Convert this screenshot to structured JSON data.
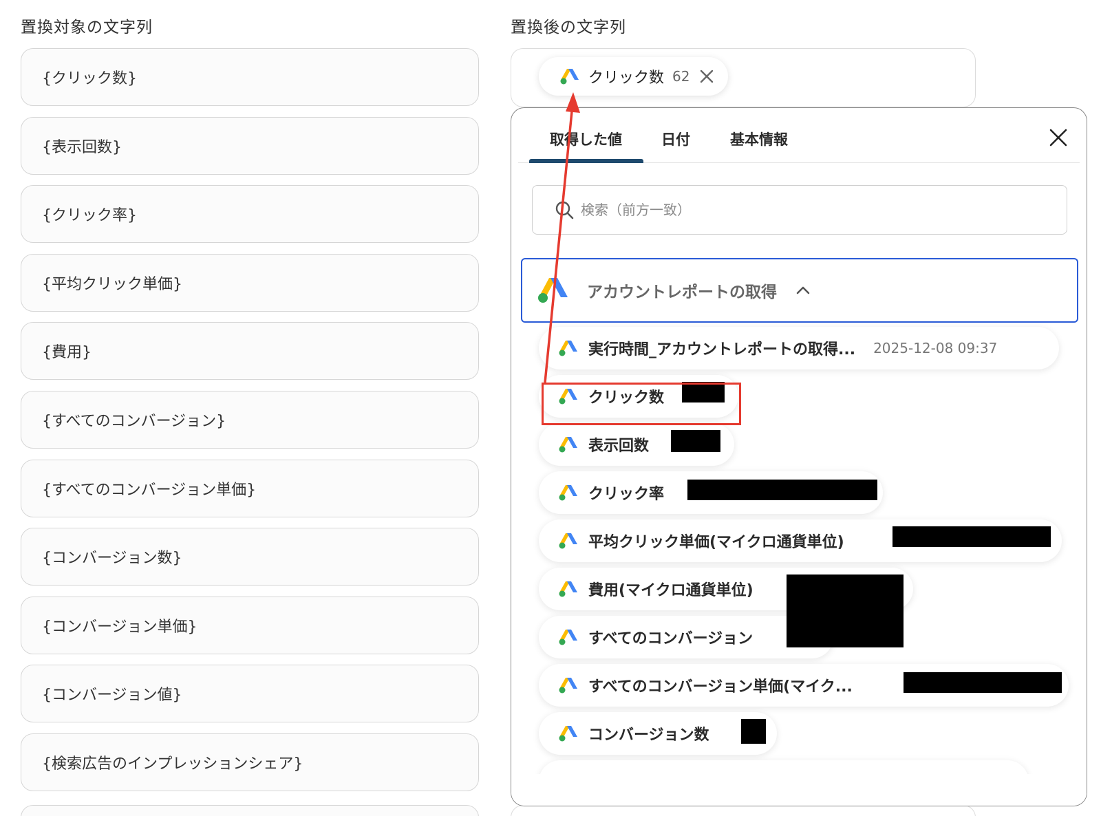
{
  "left": {
    "title": "置換対象の文字列",
    "items": [
      "{クリック数}",
      "{表示回数}",
      "{クリック率}",
      "{平均クリック単価}",
      "{費用}",
      "{すべてのコンバージョン}",
      "{すべてのコンバージョン単価}",
      "{コンバージョン数}",
      "{コンバージョン単価}",
      "{コンバージョン値}",
      "{検索広告のインプレッションシェア}"
    ]
  },
  "right": {
    "title": "置換後の文字列",
    "chip": {
      "label": "クリック数",
      "value": "62"
    }
  },
  "panel": {
    "tabs": [
      "取得した値",
      "日付",
      "基本情報"
    ],
    "active_tab": 0,
    "search_placeholder": "検索（前方一致）",
    "section_title": "アカウントレポートの取得",
    "items": [
      {
        "label": "実行時間_アカウントレポートの取得...",
        "value": "2025-12-08 09:37"
      },
      {
        "label": "クリック数",
        "value": ""
      },
      {
        "label": "表示回数",
        "value": ""
      },
      {
        "label": "クリック率",
        "value": ""
      },
      {
        "label": "平均クリック単価(マイクロ通貨単位)",
        "value": ""
      },
      {
        "label": "費用(マイクロ通貨単位)",
        "value": ""
      },
      {
        "label": "すべてのコンバージョン",
        "value": ""
      },
      {
        "label": "すべてのコンバージョン単価(マイク...",
        "value": ""
      },
      {
        "label": "コンバージョン数",
        "value": ""
      }
    ]
  },
  "colors": {
    "accent_blue": "#2a5bd7",
    "tab_bar": "#1f4a6e",
    "annotation_red": "#e53a2f",
    "google_ads_blue": "#4285F4",
    "google_ads_yellow": "#FBBC04",
    "google_ads_green": "#34A853"
  },
  "icons": [
    "google-ads-icon",
    "close-icon",
    "search-icon",
    "chevron-up-icon"
  ]
}
